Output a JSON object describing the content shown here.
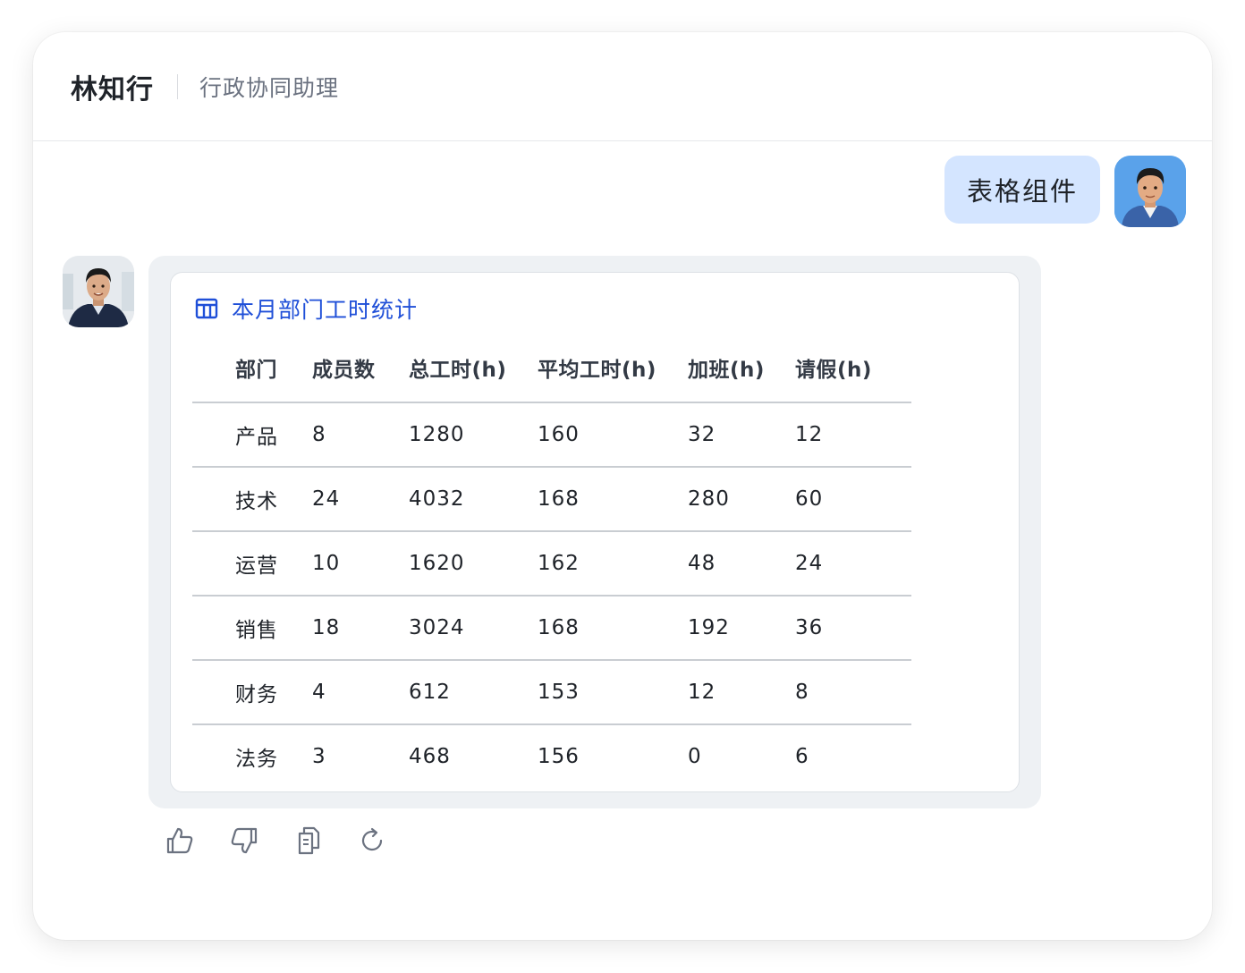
{
  "header": {
    "name": "林知行",
    "role": "行政协同助理"
  },
  "user_message": {
    "text": "表格组件"
  },
  "card": {
    "title": "本月部门工时统计",
    "icon": "table-icon",
    "columns": [
      "部门",
      "成员数",
      "总工时(h)",
      "平均工时(h)",
      "加班(h)",
      "请假(h)"
    ],
    "rows": [
      [
        "产品",
        "8",
        "1280",
        "160",
        "32",
        "12"
      ],
      [
        "技术",
        "24",
        "4032",
        "168",
        "280",
        "60"
      ],
      [
        "运营",
        "10",
        "1620",
        "162",
        "48",
        "24"
      ],
      [
        "销售",
        "18",
        "3024",
        "168",
        "192",
        "36"
      ],
      [
        "财务",
        "4",
        "612",
        "153",
        "12",
        "8"
      ],
      [
        "法务",
        "3",
        "468",
        "156",
        "0",
        "6"
      ]
    ]
  },
  "actions": [
    {
      "icon": "thumbs-up-icon"
    },
    {
      "icon": "thumbs-down-icon"
    },
    {
      "icon": "copy-icon"
    },
    {
      "icon": "refresh-icon"
    }
  ],
  "colors": {
    "user_bubble": "#d4e5ff",
    "accent": "#1f4fd8",
    "card_background": "#eef1f4"
  }
}
